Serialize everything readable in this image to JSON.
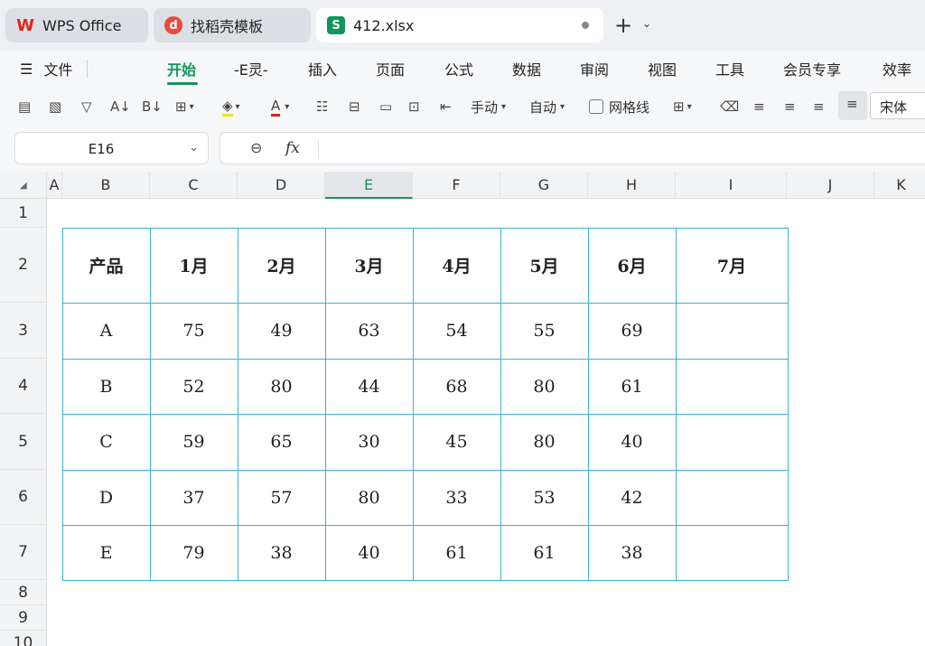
{
  "tabs": [
    {
      "label": "WPS Office",
      "icon": "wps-logo-icon"
    },
    {
      "label": "找稻壳模板",
      "icon": "docer-icon"
    },
    {
      "label": "412.xlsx",
      "icon": "spreadsheet-icon"
    }
  ],
  "file_menu": {
    "label": "文件"
  },
  "menu": [
    "开始",
    "-E灵-",
    "插入",
    "页面",
    "公式",
    "数据",
    "审阅",
    "视图",
    "工具",
    "会员专享",
    "效率"
  ],
  "toolbar": {
    "manual_label": "手动",
    "auto_label": "自动",
    "gridlines_label": "网格线",
    "font_name": "宋体"
  },
  "formula_bar": {
    "cell_ref": "E16",
    "fx_label": "fx",
    "formula": ""
  },
  "grid": {
    "columns": [
      "A",
      "B",
      "C",
      "D",
      "E",
      "F",
      "G",
      "H",
      "I",
      "J",
      "K"
    ],
    "selected_column": "E",
    "rows": [
      "1",
      "2",
      "3",
      "4",
      "5",
      "6",
      "7",
      "8",
      "9",
      "10"
    ],
    "table_header": [
      "产品",
      "1月",
      "2月",
      "3月",
      "4月",
      "5月",
      "6月",
      "7月"
    ],
    "table_rows": [
      [
        "A",
        "75",
        "49",
        "63",
        "54",
        "55",
        "69",
        ""
      ],
      [
        "B",
        "52",
        "80",
        "44",
        "68",
        "80",
        "61",
        ""
      ],
      [
        "C",
        "59",
        "65",
        "30",
        "45",
        "80",
        "40",
        ""
      ],
      [
        "D",
        "37",
        "57",
        "80",
        "33",
        "53",
        "42",
        ""
      ],
      [
        "E",
        "79",
        "38",
        "40",
        "61",
        "61",
        "38",
        ""
      ]
    ]
  },
  "colors": {
    "accent": "#12965a",
    "table_border": "#39b3d3"
  }
}
